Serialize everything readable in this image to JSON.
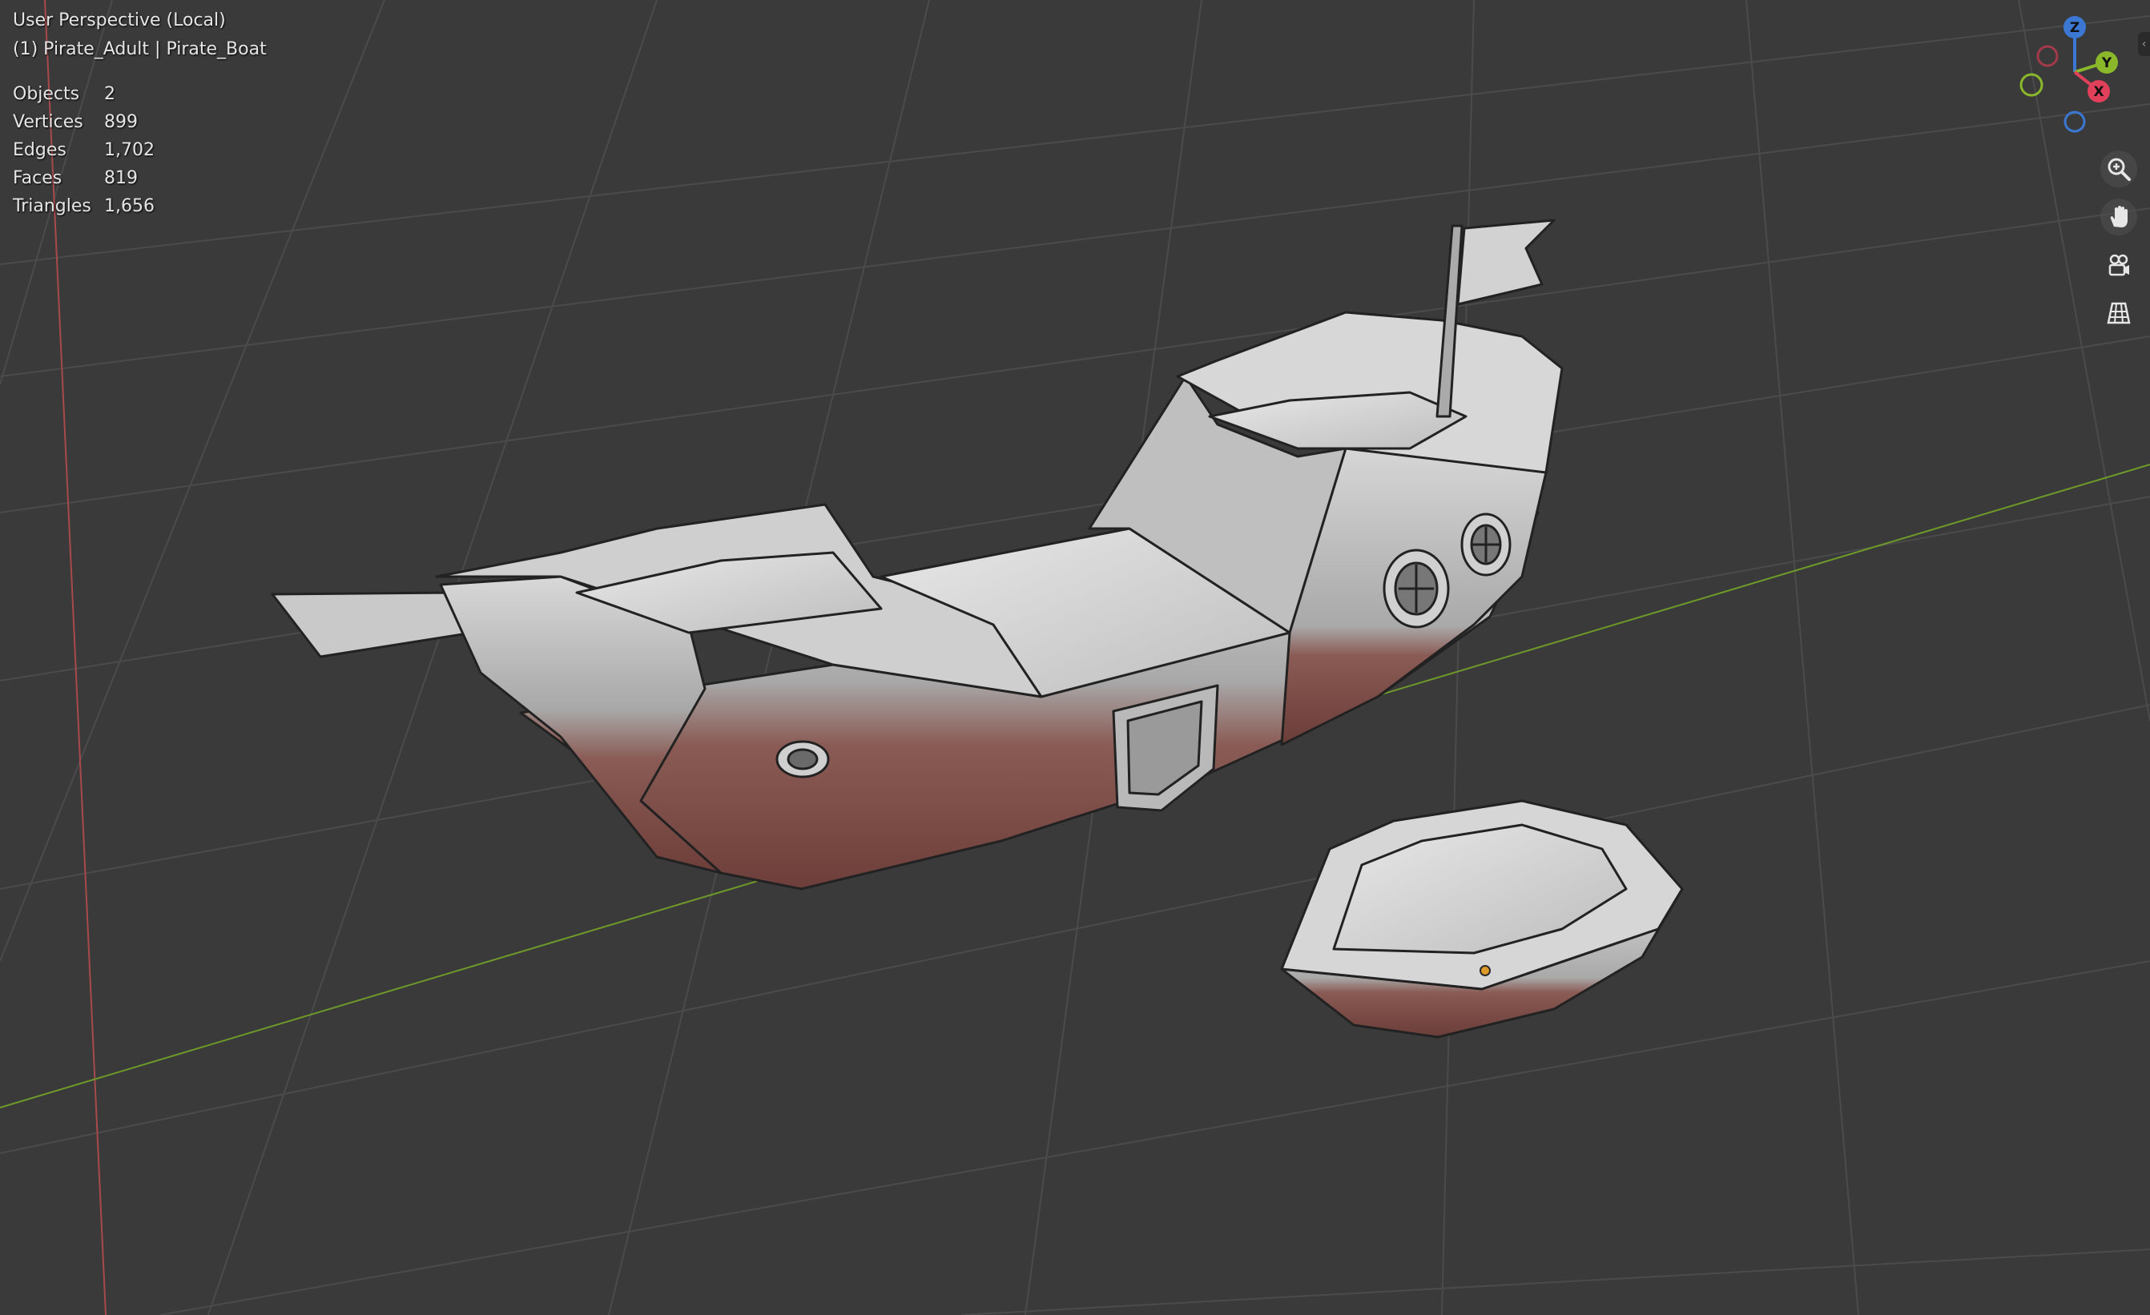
{
  "viewport": {
    "view_title": "User Perspective (Local)",
    "collection": "(1) Pirate_Adult | Pirate_Boat",
    "stats": [
      {
        "label": "Objects",
        "value": "2"
      },
      {
        "label": "Vertices",
        "value": "899"
      },
      {
        "label": "Edges",
        "value": "1,702"
      },
      {
        "label": "Faces",
        "value": "819"
      },
      {
        "label": "Triangles",
        "value": "1,656"
      }
    ]
  },
  "gizmo": {
    "z": "Z",
    "y": "Y",
    "x": "X"
  },
  "tools": [
    {
      "name": "zoom-icon"
    },
    {
      "name": "pan-hand-icon"
    },
    {
      "name": "camera-view-icon"
    },
    {
      "name": "ortho-grid-icon"
    }
  ],
  "colors": {
    "background": "#3a3a3a",
    "grid": "#4b4b4b",
    "x_axis": "#a84a4a",
    "y_axis": "#6e9a2a",
    "hull_top": "#d0d0d0",
    "hull_bottom": "#7a4a44",
    "gizmo_x": "#e0405a",
    "gizmo_y": "#8ab82a",
    "gizmo_z": "#3a78d4"
  }
}
